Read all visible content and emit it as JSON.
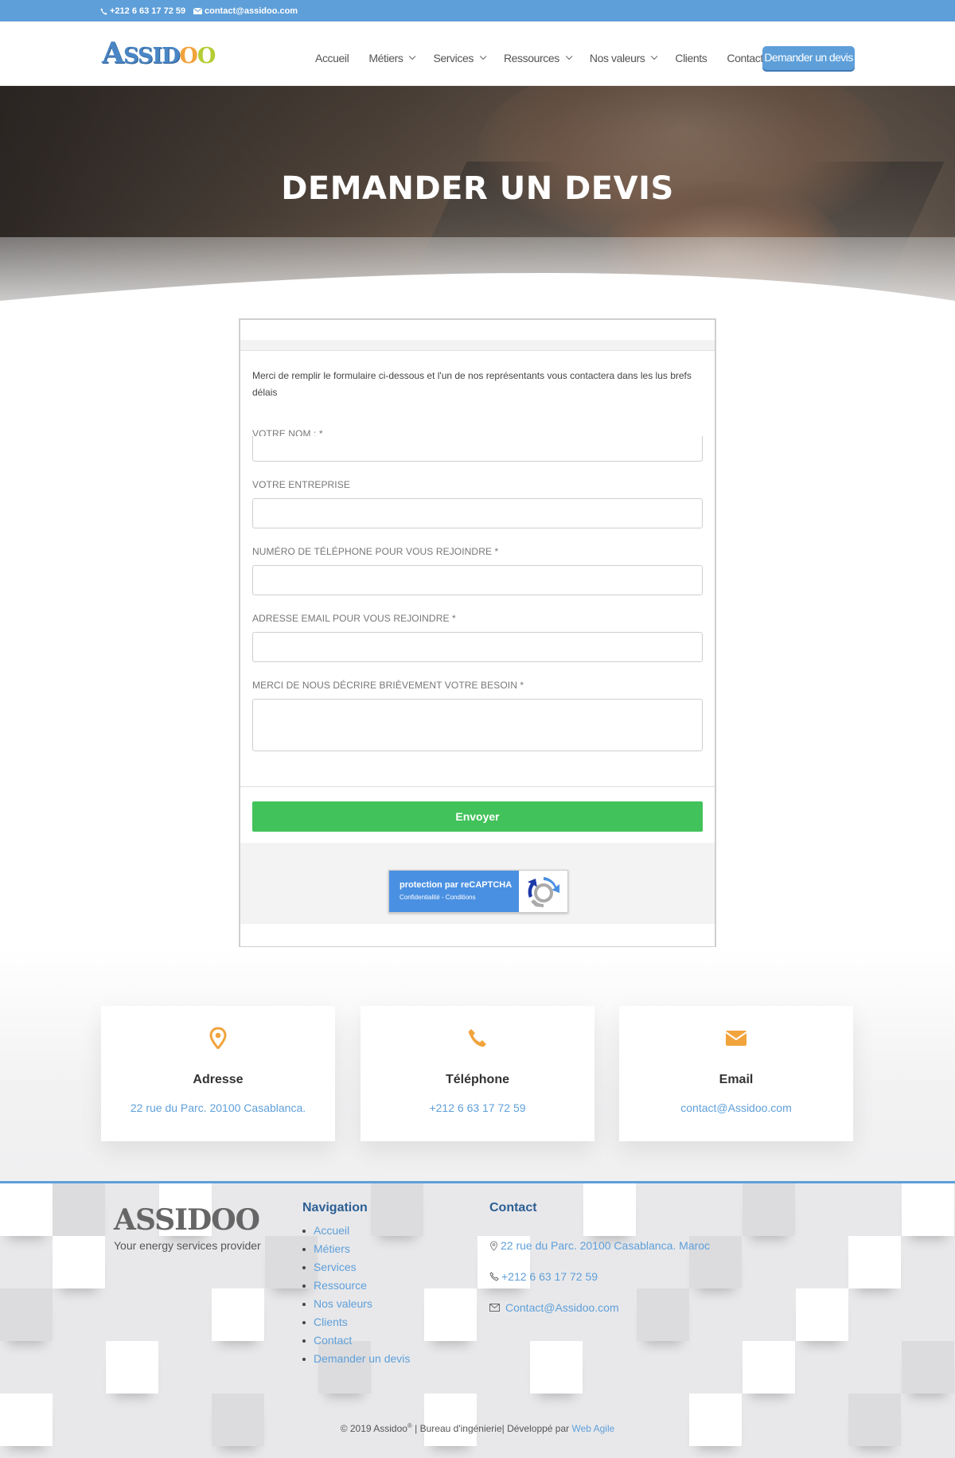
{
  "topbar": {
    "phone": "+212 6 63 17 72 59",
    "email": "contact@assidoo.com"
  },
  "header": {
    "logo": {
      "part1": "A",
      "part2": "SSID",
      "part3": "O",
      "part4": "O"
    },
    "nav": [
      {
        "label": "Accueil",
        "dropdown": false
      },
      {
        "label": "Métiers",
        "dropdown": true
      },
      {
        "label": "Services",
        "dropdown": true
      },
      {
        "label": "Ressources",
        "dropdown": true
      },
      {
        "label": "Nos valeurs",
        "dropdown": true
      },
      {
        "label": "Clients",
        "dropdown": false
      },
      {
        "label": "Contact",
        "dropdown": false
      }
    ],
    "cta_label": "Demander un devis"
  },
  "hero": {
    "title": "DEMANDER UN DEVIS"
  },
  "form": {
    "intro": "Merci de remplir le formulaire ci-dessous et l'un de nos représentants vous contactera dans les lus brefs délais",
    "fields": [
      {
        "label": "VOTRE NOM : *"
      },
      {
        "label": "VOTRE ENTREPRISE"
      },
      {
        "label": "NUMÉRO DE TÉLÉPHONE POUR VOUS REJOINDRE *"
      },
      {
        "label": "ADRESSE EMAIL POUR VOUS REJOINDRE *"
      },
      {
        "label": "MERCI DE NOUS DÉCRIRE BRIÈVEMENT VOTRE BESOIN *"
      }
    ],
    "submit_label": "Envoyer",
    "recaptcha": {
      "line1": "protection par reCAPTCHA",
      "line2": "Confidentialité - Conditions"
    }
  },
  "contact_cards": [
    {
      "icon": "map-pin-icon",
      "title": "Adresse",
      "value": "22 rue du Parc. 20100 Casablanca."
    },
    {
      "icon": "phone-icon",
      "title": "Téléphone",
      "value": "+212 6 63 17 72 59"
    },
    {
      "icon": "envelope-icon",
      "title": "Email",
      "value": "contact@Assidoo.com"
    }
  ],
  "footer": {
    "tagline": "Your energy services provider",
    "nav_title": "Navigation",
    "nav_items": [
      "Accueil",
      "Métiers",
      "Services",
      "Ressource",
      "Nos valeurs",
      "Clients",
      "Contact",
      "Demander un devis"
    ],
    "contact_title": "Contact",
    "address": "22 rue du Parc. 20100 Casablanca. Maroc",
    "phone": "+212 6 63 17 72 59",
    "email": "Contact@Assidoo.com",
    "copyright_prefix": "© 2019 Assidoo",
    "copyright_sup": "®",
    "copyright_middle": " | Bureau d'ingénierie| Développé par ",
    "copyright_link": "Web Agile"
  },
  "colors": {
    "brand_blue": "#5e9fd9",
    "accent_orange": "#f1a33c",
    "submit_green": "#42c25a"
  }
}
